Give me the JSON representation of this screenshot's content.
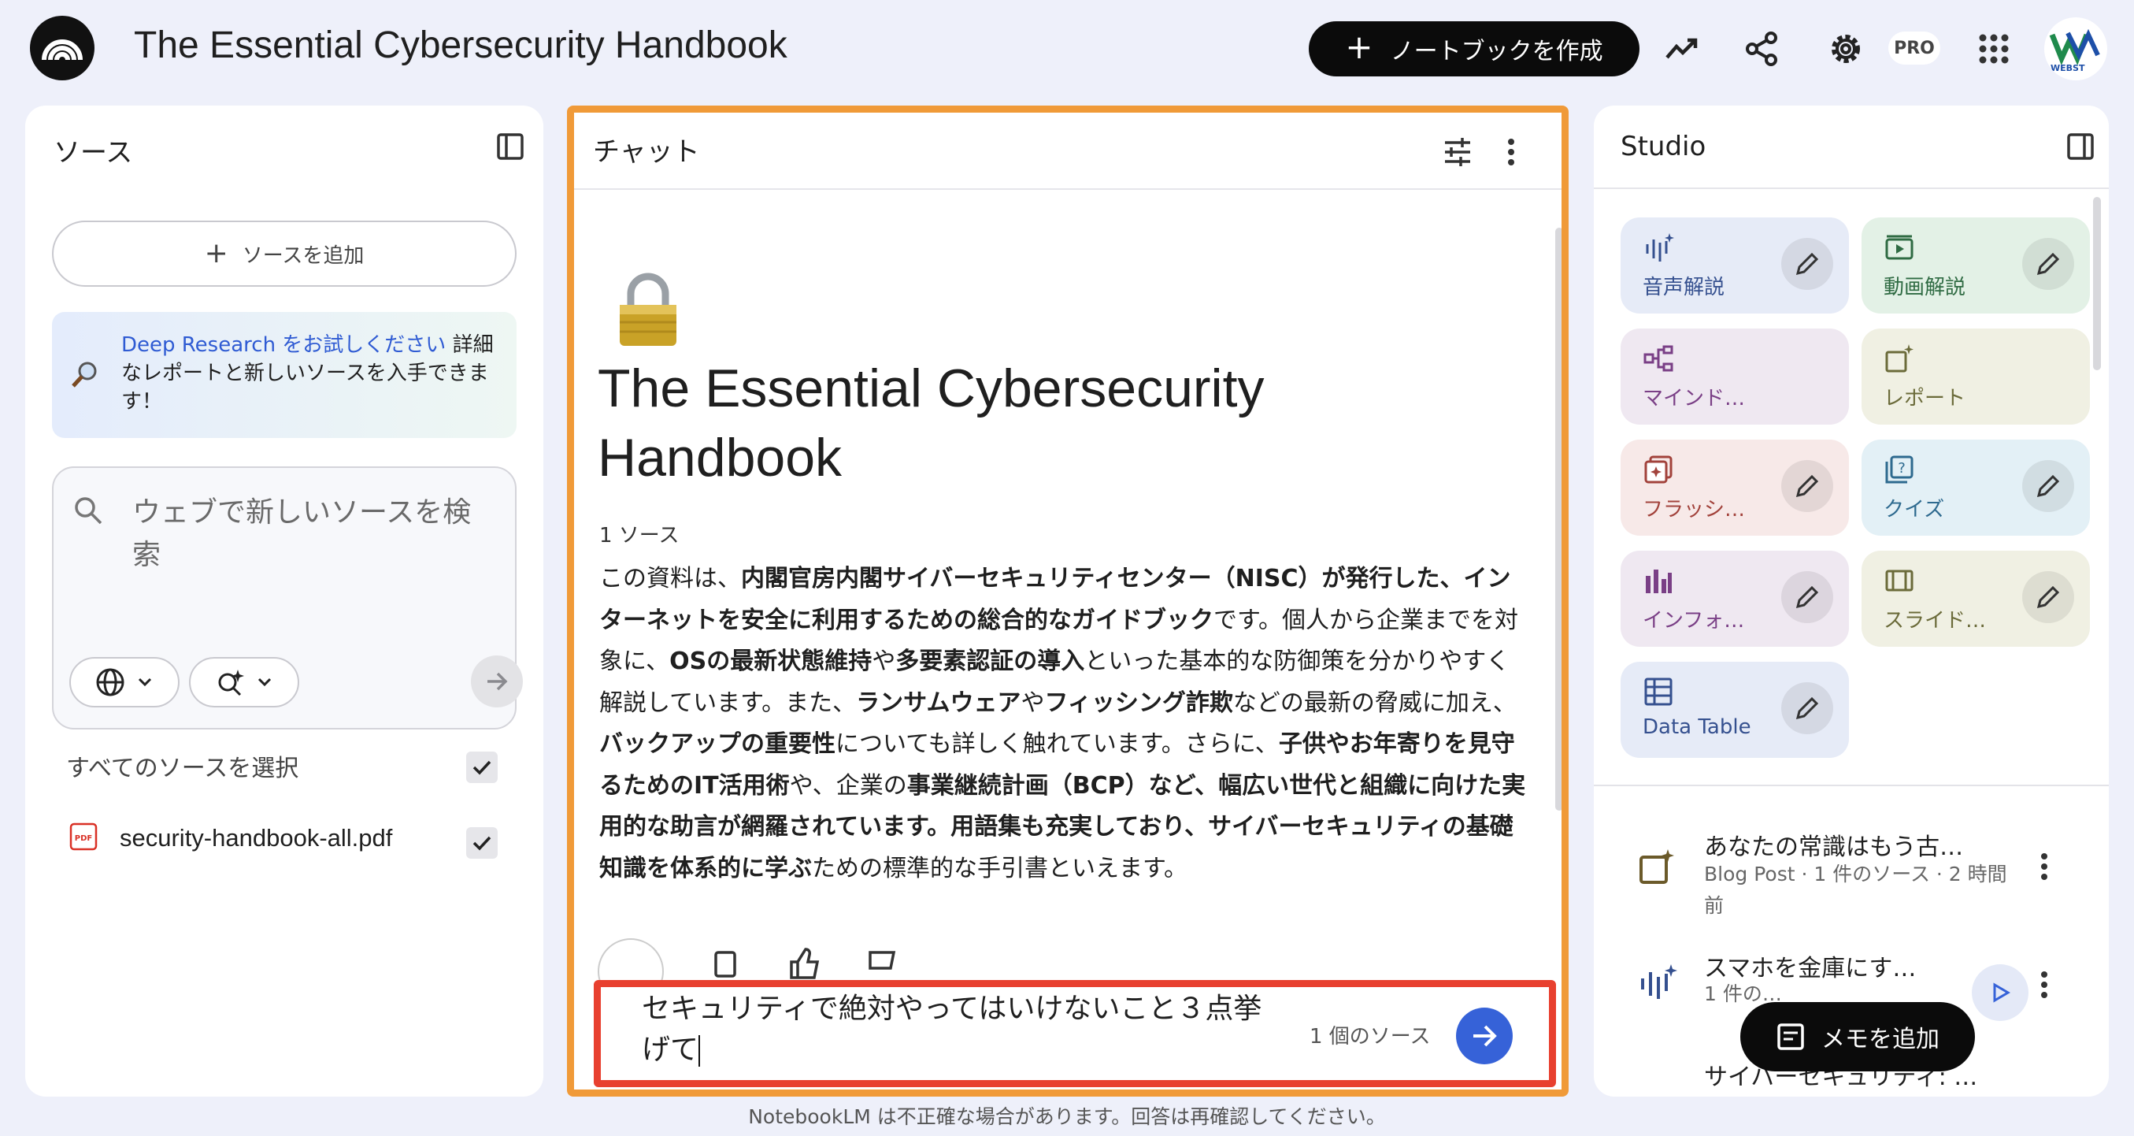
{
  "header": {
    "title": "The Essential Cybersecurity Handbook",
    "create_notebook": "ノートブックを作成",
    "pro_badge": "PRO",
    "avatar_text": "WEBST"
  },
  "sources_panel": {
    "title": "ソース",
    "add_source": "ソースを追加",
    "deep_research_link": "Deep Research をお試しください",
    "deep_research_text": " 詳細なレポートと新しいソースを入手できます！",
    "search_placeholder": "ウェブで新しいソースを検索",
    "select_all": "すべてのソースを選択",
    "files": [
      {
        "name": "security-handbook-all.pdf",
        "type_label": "PDF",
        "checked": true
      }
    ]
  },
  "chat_panel": {
    "title": "チャット",
    "notebook_title": "The Essential Cybersecurity Handbook",
    "source_count": "1 ソース",
    "summary_parts": [
      {
        "text": "この資料は、",
        "bold": false
      },
      {
        "text": "内閣官房内閣サイバーセキュリティセンター（NISC）が発行した、インターネットを安全に利用するための総合的なガイドブック",
        "bold": true
      },
      {
        "text": "です。個人から企業までを対象に、",
        "bold": false
      },
      {
        "text": "OSの最新状態維持",
        "bold": true
      },
      {
        "text": "や",
        "bold": false
      },
      {
        "text": "多要素認証の導入",
        "bold": true
      },
      {
        "text": "といった基本的な防御策を分かりやすく解説しています。また、",
        "bold": false
      },
      {
        "text": "ランサムウェア",
        "bold": true
      },
      {
        "text": "や",
        "bold": false
      },
      {
        "text": "フィッシング詐欺",
        "bold": true
      },
      {
        "text": "などの最新の脅威に加え、",
        "bold": false
      },
      {
        "text": "バックアップの重要性",
        "bold": true
      },
      {
        "text": "についても詳しく触れています。さらに、",
        "bold": false
      },
      {
        "text": "子供やお年寄りを見守るためのIT活用術",
        "bold": true
      },
      {
        "text": "や、企業の",
        "bold": false
      },
      {
        "text": "事業継続計画（BCP）など、幅広い世代と組織に向けた実用的な助言が網羅されています。用語集も充実しており、サイバーセキュリティの基礎知識を体系的に学ぶ",
        "bold": true
      },
      {
        "text": "ための標準的な手引書といえます。",
        "bold": false
      }
    ],
    "input_value": "セキュリティで絶対やってはいけないこと３点挙げて",
    "input_sources": "1 個のソース"
  },
  "studio_panel": {
    "title": "Studio",
    "tiles": [
      {
        "label": "音声解説",
        "icon": "audio-wave-icon",
        "bg": "#e6ebf7",
        "color": "#35508f"
      },
      {
        "label": "動画解説",
        "icon": "video-icon",
        "bg": "#e3f1e6",
        "color": "#2f6b43"
      },
      {
        "label": "マインド…",
        "icon": "mindmap-icon",
        "bg": "#efe8f1",
        "color": "#7a3f86"
      },
      {
        "label": "レポート",
        "icon": "report-icon",
        "bg": "#f0f0e3",
        "color": "#6b6b3a"
      },
      {
        "label": "フラッシ…",
        "icon": "flashcard-icon",
        "bg": "#f7e9e8",
        "color": "#a2423b"
      },
      {
        "label": "クイズ",
        "icon": "quiz-icon",
        "bg": "#e3f0f6",
        "color": "#2e6a8f"
      },
      {
        "label": "インフォ…",
        "icon": "infographic-icon",
        "bg": "#efe8f1",
        "color": "#7a3f86"
      },
      {
        "label": "スライド…",
        "icon": "slides-icon",
        "bg": "#f0f0e3",
        "color": "#6b6b3a"
      },
      {
        "label": "Data Table",
        "icon": "table-icon",
        "bg": "#e6ebf7",
        "color": "#35508f"
      }
    ],
    "notes": [
      {
        "title": "あなたの常識はもう古…",
        "meta": "Blog Post · 1 件のソース · 2 時間前",
        "icon": "report-icon"
      },
      {
        "title": "スマホを金庫にす…",
        "meta": "1 件の…",
        "icon": "audio-wave-icon"
      },
      {
        "title": "サイバーセキュリティ: …",
        "meta": "",
        "icon": ""
      }
    ],
    "add_memo": "メモを追加"
  },
  "footer": "NotebookLM は不正確な場合があります。回答は再確認してください。"
}
